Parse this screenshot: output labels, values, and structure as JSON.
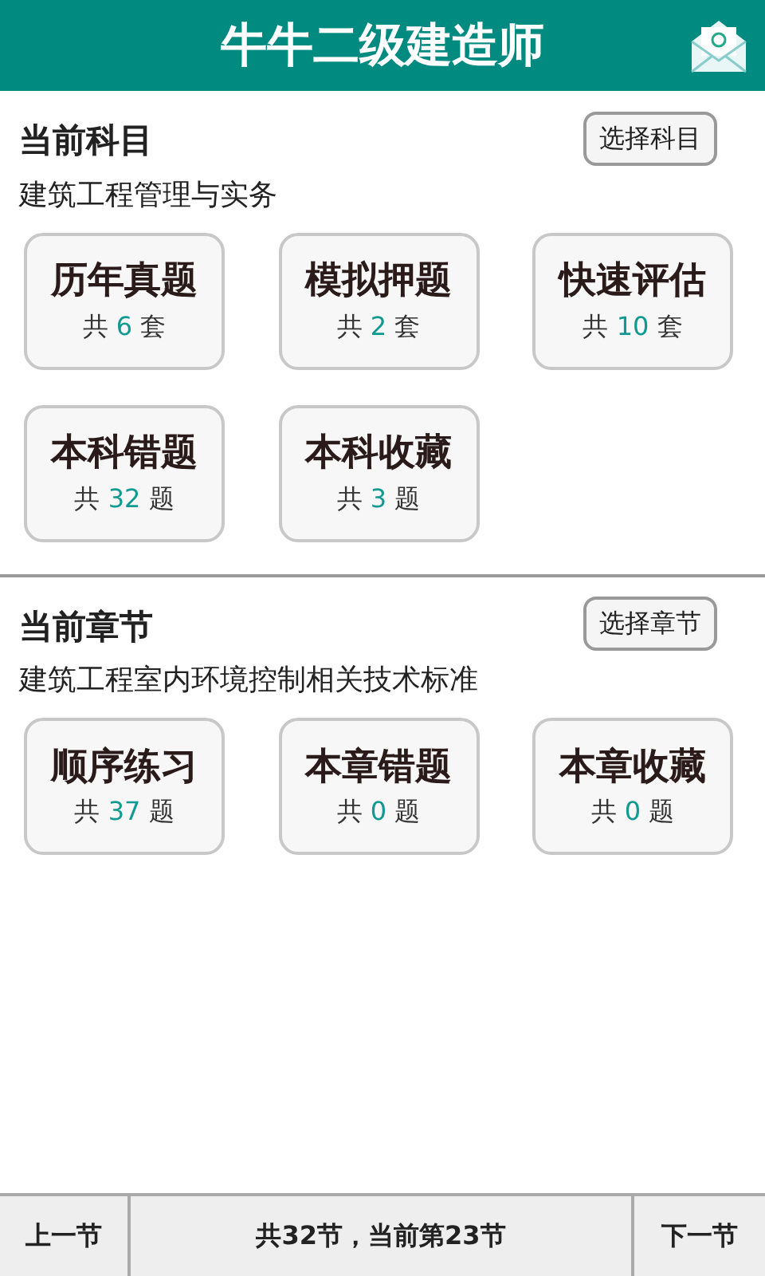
{
  "header": {
    "title": "牛牛二级建造师"
  },
  "sections": [
    {
      "title": "当前科目",
      "button": "选择科目",
      "subtitle": "建筑工程管理与实务",
      "cards": [
        {
          "label": "历年真题",
          "prefix": "共",
          "count": "6",
          "unit": "套"
        },
        {
          "label": "模拟押题",
          "prefix": "共",
          "count": "2",
          "unit": "套"
        },
        {
          "label": "快速评估",
          "prefix": "共",
          "count": "10",
          "unit": "套"
        },
        {
          "label": "本科错题",
          "prefix": "共",
          "count": "32",
          "unit": "题"
        },
        {
          "label": "本科收藏",
          "prefix": "共",
          "count": "3",
          "unit": "题"
        }
      ]
    },
    {
      "title": "当前章节",
      "button": "选择章节",
      "subtitle": "建筑工程室内环境控制相关技术标准",
      "cards": [
        {
          "label": "顺序练习",
          "prefix": "共",
          "count": "37",
          "unit": "题"
        },
        {
          "label": "本章错题",
          "prefix": "共",
          "count": "0",
          "unit": "题"
        },
        {
          "label": "本章收藏",
          "prefix": "共",
          "count": "0",
          "unit": "题"
        }
      ]
    }
  ],
  "footer": {
    "prev": "上一节",
    "status": "共32节，当前第23节",
    "next": "下一节"
  }
}
